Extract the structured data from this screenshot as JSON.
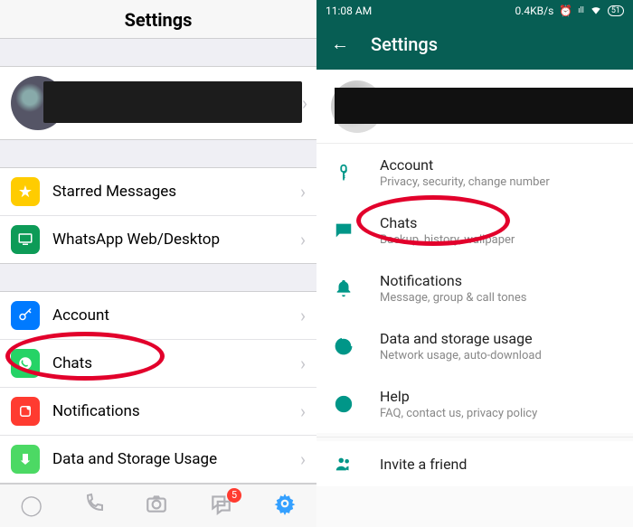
{
  "left": {
    "title": "Settings",
    "starred": "Starred Messages",
    "web": "WhatsApp Web/Desktop",
    "account": "Account",
    "chats": "Chats",
    "notifications": "Notifications",
    "data": "Data and Storage Usage",
    "badge_count": "5"
  },
  "right": {
    "status": {
      "time": "11:08 AM",
      "net": "0.4KB/s",
      "battery": "51"
    },
    "title": "Settings",
    "items": [
      {
        "title": "Account",
        "subtitle": "Privacy, security, change number"
      },
      {
        "title": "Chats",
        "subtitle": "Backup, history, wallpaper"
      },
      {
        "title": "Notifications",
        "subtitle": "Message, group & call tones"
      },
      {
        "title": "Data and storage usage",
        "subtitle": "Network usage, auto-download"
      },
      {
        "title": "Help",
        "subtitle": "FAQ, contact us, privacy policy"
      }
    ],
    "invite": "Invite a friend"
  }
}
